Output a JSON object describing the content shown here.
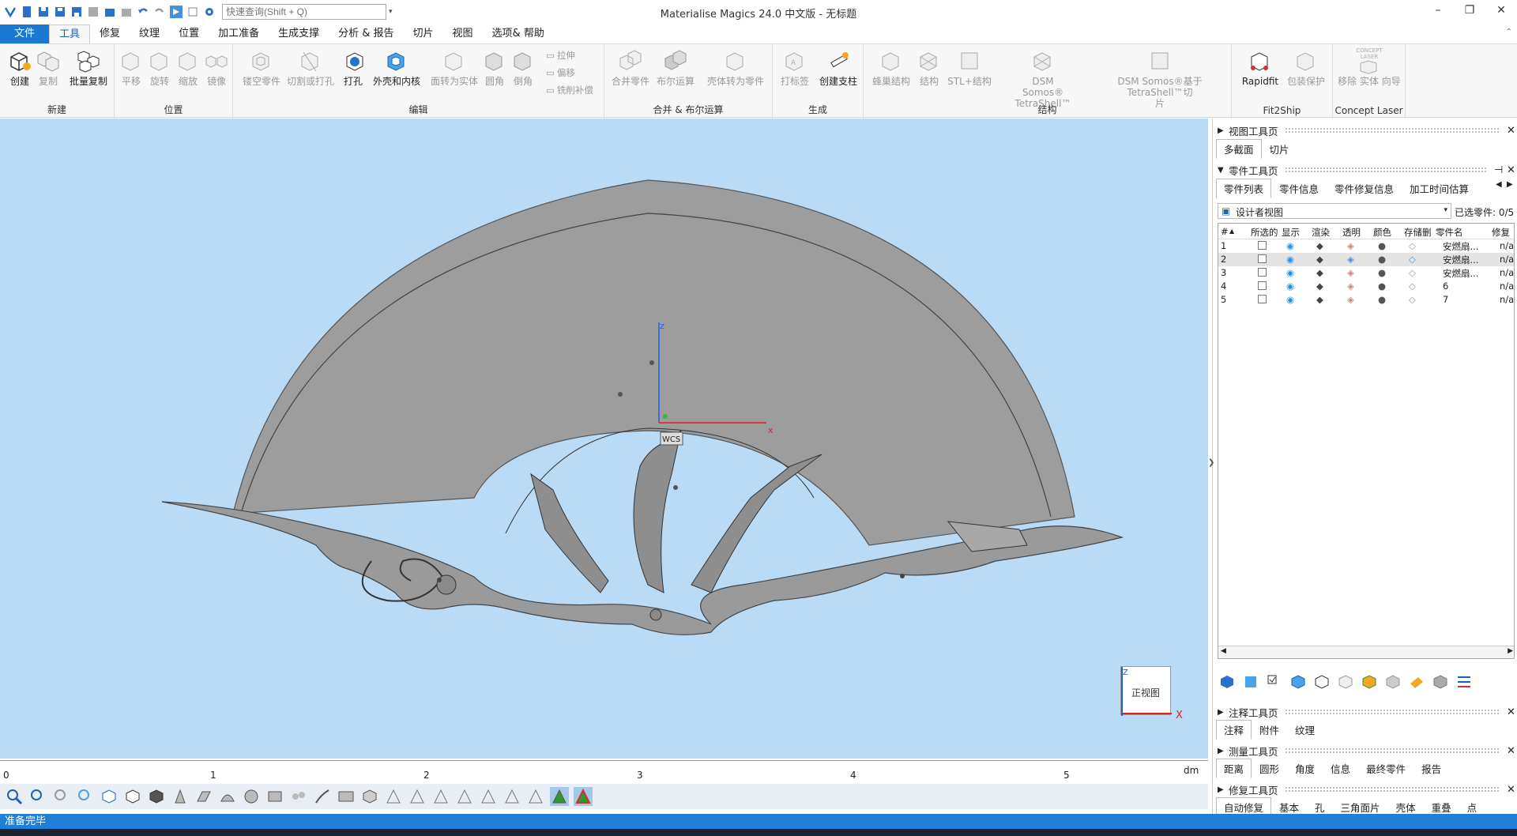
{
  "app": {
    "title": "Materialise Magics 24.0 中文版 - 无标题",
    "search_placeholder": "快速查询(Shift + Q)"
  },
  "menu": {
    "file": "文件",
    "tabs": [
      "工具",
      "修复",
      "纹理",
      "位置",
      "加工准备",
      "生成支撑",
      "分析 & 报告",
      "切片",
      "视图",
      "选项& 帮助"
    ]
  },
  "ribbon": {
    "groups": [
      "新建",
      "位置",
      "编辑",
      "合并 & 布尔运算",
      "生成",
      "结构",
      "Fit2Ship",
      "Concept Laser"
    ],
    "buttons": {
      "create": "创建",
      "copy": "复制",
      "batch_copy": "批量复制",
      "translate": "平移",
      "rotate": "旋转",
      "scale": "缩放",
      "mirror": "镜像",
      "hollow": "镂空零件",
      "cut_punch": "切割或打孔",
      "punch": "打孔",
      "shell_core": "外壳和内核",
      "surface_solid": "面转为实体",
      "fillet": "圆角",
      "chamfer": "倒角",
      "extrude": "拉伸",
      "offset": "偏移",
      "mill_comp": "铣削补偿",
      "merge": "合并零件",
      "boolean": "布尔运算",
      "shell_to_part": "壳体转为零件",
      "label": "打标签",
      "create_support": "创建支柱",
      "honeycomb": "蜂巢结构",
      "structure": "结构",
      "stl_structure": "STL+结构",
      "dsm1_line1": "DSM",
      "dsm1_line2": "Somos® TetraShell™",
      "dsm2_line1": "DSM Somos®基于TetraShell™切",
      "dsm2_line2": "片",
      "rapidfit": "Rapidfit",
      "pack_protect": "包装保护",
      "concept_laser_logo": "CONCEPT LASER",
      "remove_solid_wizard": "移除 实体 向导"
    }
  },
  "viewport": {
    "wcs_label": "WCS",
    "axis_x": "x",
    "axis_z": "z",
    "viewcube_label": "正视图",
    "viewcube_z": "Z",
    "viewcube_x": "X",
    "ruler_ticks": [
      "0",
      "1",
      "2",
      "3",
      "4",
      "5"
    ],
    "ruler_unit": "dm"
  },
  "right_panel": {
    "view_toolpage": "视图工具页",
    "view_tabs": [
      "多截面",
      "切片"
    ],
    "part_toolpage": "零件工具页",
    "part_tabs": [
      "零件列表",
      "零件信息",
      "零件修复信息",
      "加工时间估算",
      " "
    ],
    "designer_view": "设计者视图",
    "selected_parts_label": "已选零件:",
    "selected_parts_value": "0/5",
    "columns": [
      "#",
      "所选的",
      "显示",
      "渲染",
      "透明",
      "颜色",
      "存储删",
      "零件名",
      "修复"
    ],
    "rows": [
      {
        "num": "1",
        "name": "安燃扇...",
        "fix": "n/a"
      },
      {
        "num": "2",
        "name": "安燃扇...",
        "fix": "n/a"
      },
      {
        "num": "3",
        "name": "安燃扇...",
        "fix": "n/a"
      },
      {
        "num": "4",
        "name": "6",
        "fix": "n/a"
      },
      {
        "num": "5",
        "name": "7",
        "fix": "n/a"
      }
    ],
    "annotation_toolpage": "注释工具页",
    "annotation_tabs": [
      "注释",
      "附件",
      "纹理"
    ],
    "measure_toolpage": "测量工具页",
    "measure_tabs": [
      "距离",
      "圆形",
      "角度",
      "信息",
      "最终零件",
      "报告"
    ],
    "repair_toolpage": "修复工具页",
    "repair_tabs": [
      "自动修复",
      "基本",
      "孔",
      "三角面片",
      "壳体",
      "重叠",
      "点"
    ]
  },
  "status": {
    "text": "准备完毕"
  },
  "colors": {
    "accent": "#1b78d0",
    "viewport_bg": "#b9dbf6",
    "part_gray": "#9a9a9a",
    "status_bar": "#1f7fd6"
  }
}
